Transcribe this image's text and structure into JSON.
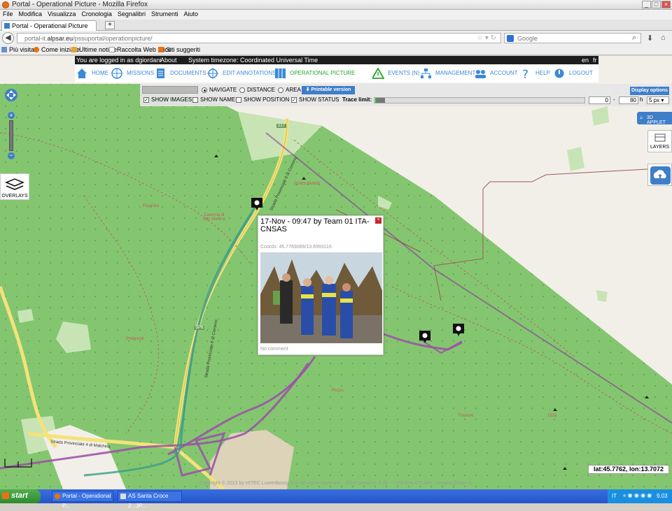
{
  "browser": {
    "window_title": "Portal - Operational Picture - Mozilla Firefox",
    "menu": [
      "File",
      "Modifica",
      "Visualizza",
      "Cronologia",
      "Segnalibri",
      "Strumenti",
      "Aiuto"
    ],
    "tab_title": "Portal - Operational Picture",
    "new_tab": "+",
    "url_prefix": "portal-it.",
    "url_host": "alpsar.eu",
    "url_path": "/pssuportal/operationpicture/",
    "search_placeholder": "Google",
    "bookmarks": [
      "Più visitati",
      "Come iniziare",
      "Ultime notizie",
      "Raccolta Web Slice",
      "Siti suggeriti"
    ]
  },
  "portal": {
    "login_text": "You are logged in as dgiordani",
    "about": "About",
    "timezone": "System timezone: Coordinated Universal Time",
    "lang_en": "en",
    "lang_fr": "fr",
    "menu": {
      "home": "HOME",
      "missions": "MISSIONS",
      "documents": "DOCUMENTS",
      "edit_annotations": "EDIT ANNOTATIONS",
      "operational_picture": "OPERATIONAL PICTURE",
      "events": "EVENTS (N)",
      "management": "MANAGEMENT",
      "account": "ACCOUNT",
      "help": "HELP",
      "logout": "LOGOUT"
    }
  },
  "toolbar": {
    "mode_navigate": "NAVIGATE",
    "mode_distance": "DISTANCE",
    "mode_area": "AREA",
    "selected_mode": "navigate",
    "printable": "Printable version",
    "display_options": "Display options",
    "show_images": "SHOW IMAGES",
    "show_images_checked": true,
    "show_name": "SHOW NAME",
    "show_name_checked": false,
    "show_position": "SHOW POSITION",
    "show_position_checked": false,
    "show_status": "SHOW STATUS",
    "show_status_checked": true,
    "trace_limit_label": "Trace limit:",
    "trace_min": "0",
    "trace_max": "80",
    "trace_unit": "h",
    "trace_sep": "-",
    "px_size": "5 px"
  },
  "map_controls": {
    "overlays": "OVERLAYS",
    "applet": "3D APPLET",
    "layers": "LAYERS",
    "coords_readout": "lat:45.7762, lon:13.7072"
  },
  "map_labels": {
    "road_sp6": "Strada Provinciale 6 di Comeno",
    "road_sp6b": "Strada Provinciale 6 di Comeno",
    "road_sp4": "Strada Provinciale 4 di Malchina",
    "road_num_top": "517",
    "road_num_mid": "SP6"
  },
  "popup": {
    "title": "17-Nov - 09:47 by Team 01 ITA-CNSAS",
    "coords": "Coords: 45.7769089/13.6993116",
    "comment": "No comment",
    "close": "×"
  },
  "footer": "Copyright © 2013 by HITEC Luxembourg S.A. All rights reserved. - DISP portal v1.9.40 - +352.498.478.498 - nosaco@hitec.lu",
  "taskbar": {
    "start": "start",
    "tasks": [
      "Portal - Operational P...",
      "AS Santa Croce 2...JP..."
    ],
    "lang": "IT",
    "time": "9.03"
  },
  "colors": {
    "forest": "#84c670",
    "background": "#f2efe9",
    "trace_purple": "#9b4fa8",
    "trace_teal": "#3a9e8a",
    "accent_blue": "#3f7ec8"
  }
}
